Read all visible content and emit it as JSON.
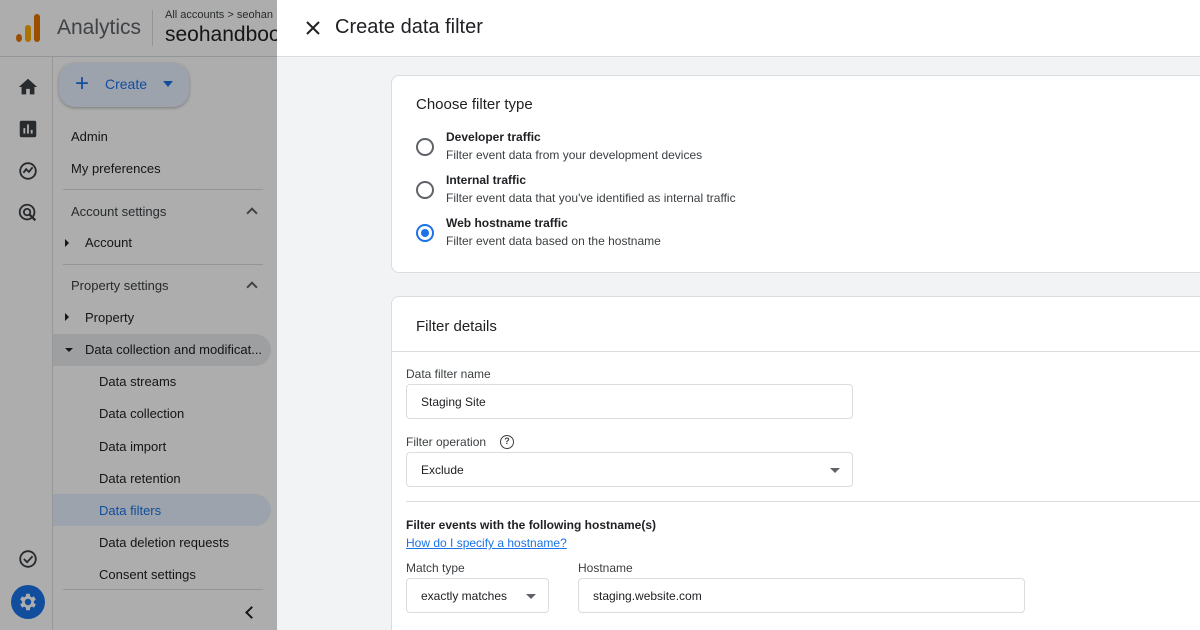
{
  "app": {
    "product_name": "Analytics",
    "breadcrumb": "All accounts > seohan",
    "property_name": "seohandboo"
  },
  "nav": {
    "create_label": "Create",
    "admin": "Admin",
    "my_preferences": "My preferences",
    "account_settings": "Account settings",
    "account": "Account",
    "property_settings": "Property settings",
    "property": "Property",
    "data_collection_group": "Data collection and modificat...",
    "sub_items": [
      "Data streams",
      "Data collection",
      "Data import",
      "Data retention",
      "Data filters",
      "Data deletion requests",
      "Consent settings"
    ],
    "active_item": "Data filters"
  },
  "panel": {
    "title": "Create data filter",
    "filter_type": {
      "heading": "Choose filter type",
      "options": [
        {
          "title": "Developer traffic",
          "description": "Filter event data from your development devices",
          "checked": false
        },
        {
          "title": "Internal traffic",
          "description": "Filter event data that you've identified as internal traffic",
          "checked": false
        },
        {
          "title": "Web hostname traffic",
          "description": "Filter event data based on the hostname",
          "checked": true
        }
      ]
    },
    "filter_details": {
      "heading": "Filter details",
      "name_label": "Data filter name",
      "name_value": "Staging Site",
      "operation_label": "Filter operation",
      "operation_value": "Exclude",
      "hostname_heading": "Filter events with the following hostname(s)",
      "hostname_help_link": "How do I specify a hostname?",
      "match_type_label": "Match type",
      "match_type_value": "exactly matches",
      "hostname_label": "Hostname",
      "hostname_value": "staging.website.com"
    }
  },
  "colors": {
    "accent": "#1a73e8",
    "selected_nav_bg": "#e8f0fe",
    "panel_bg": "#f1f3f4"
  }
}
